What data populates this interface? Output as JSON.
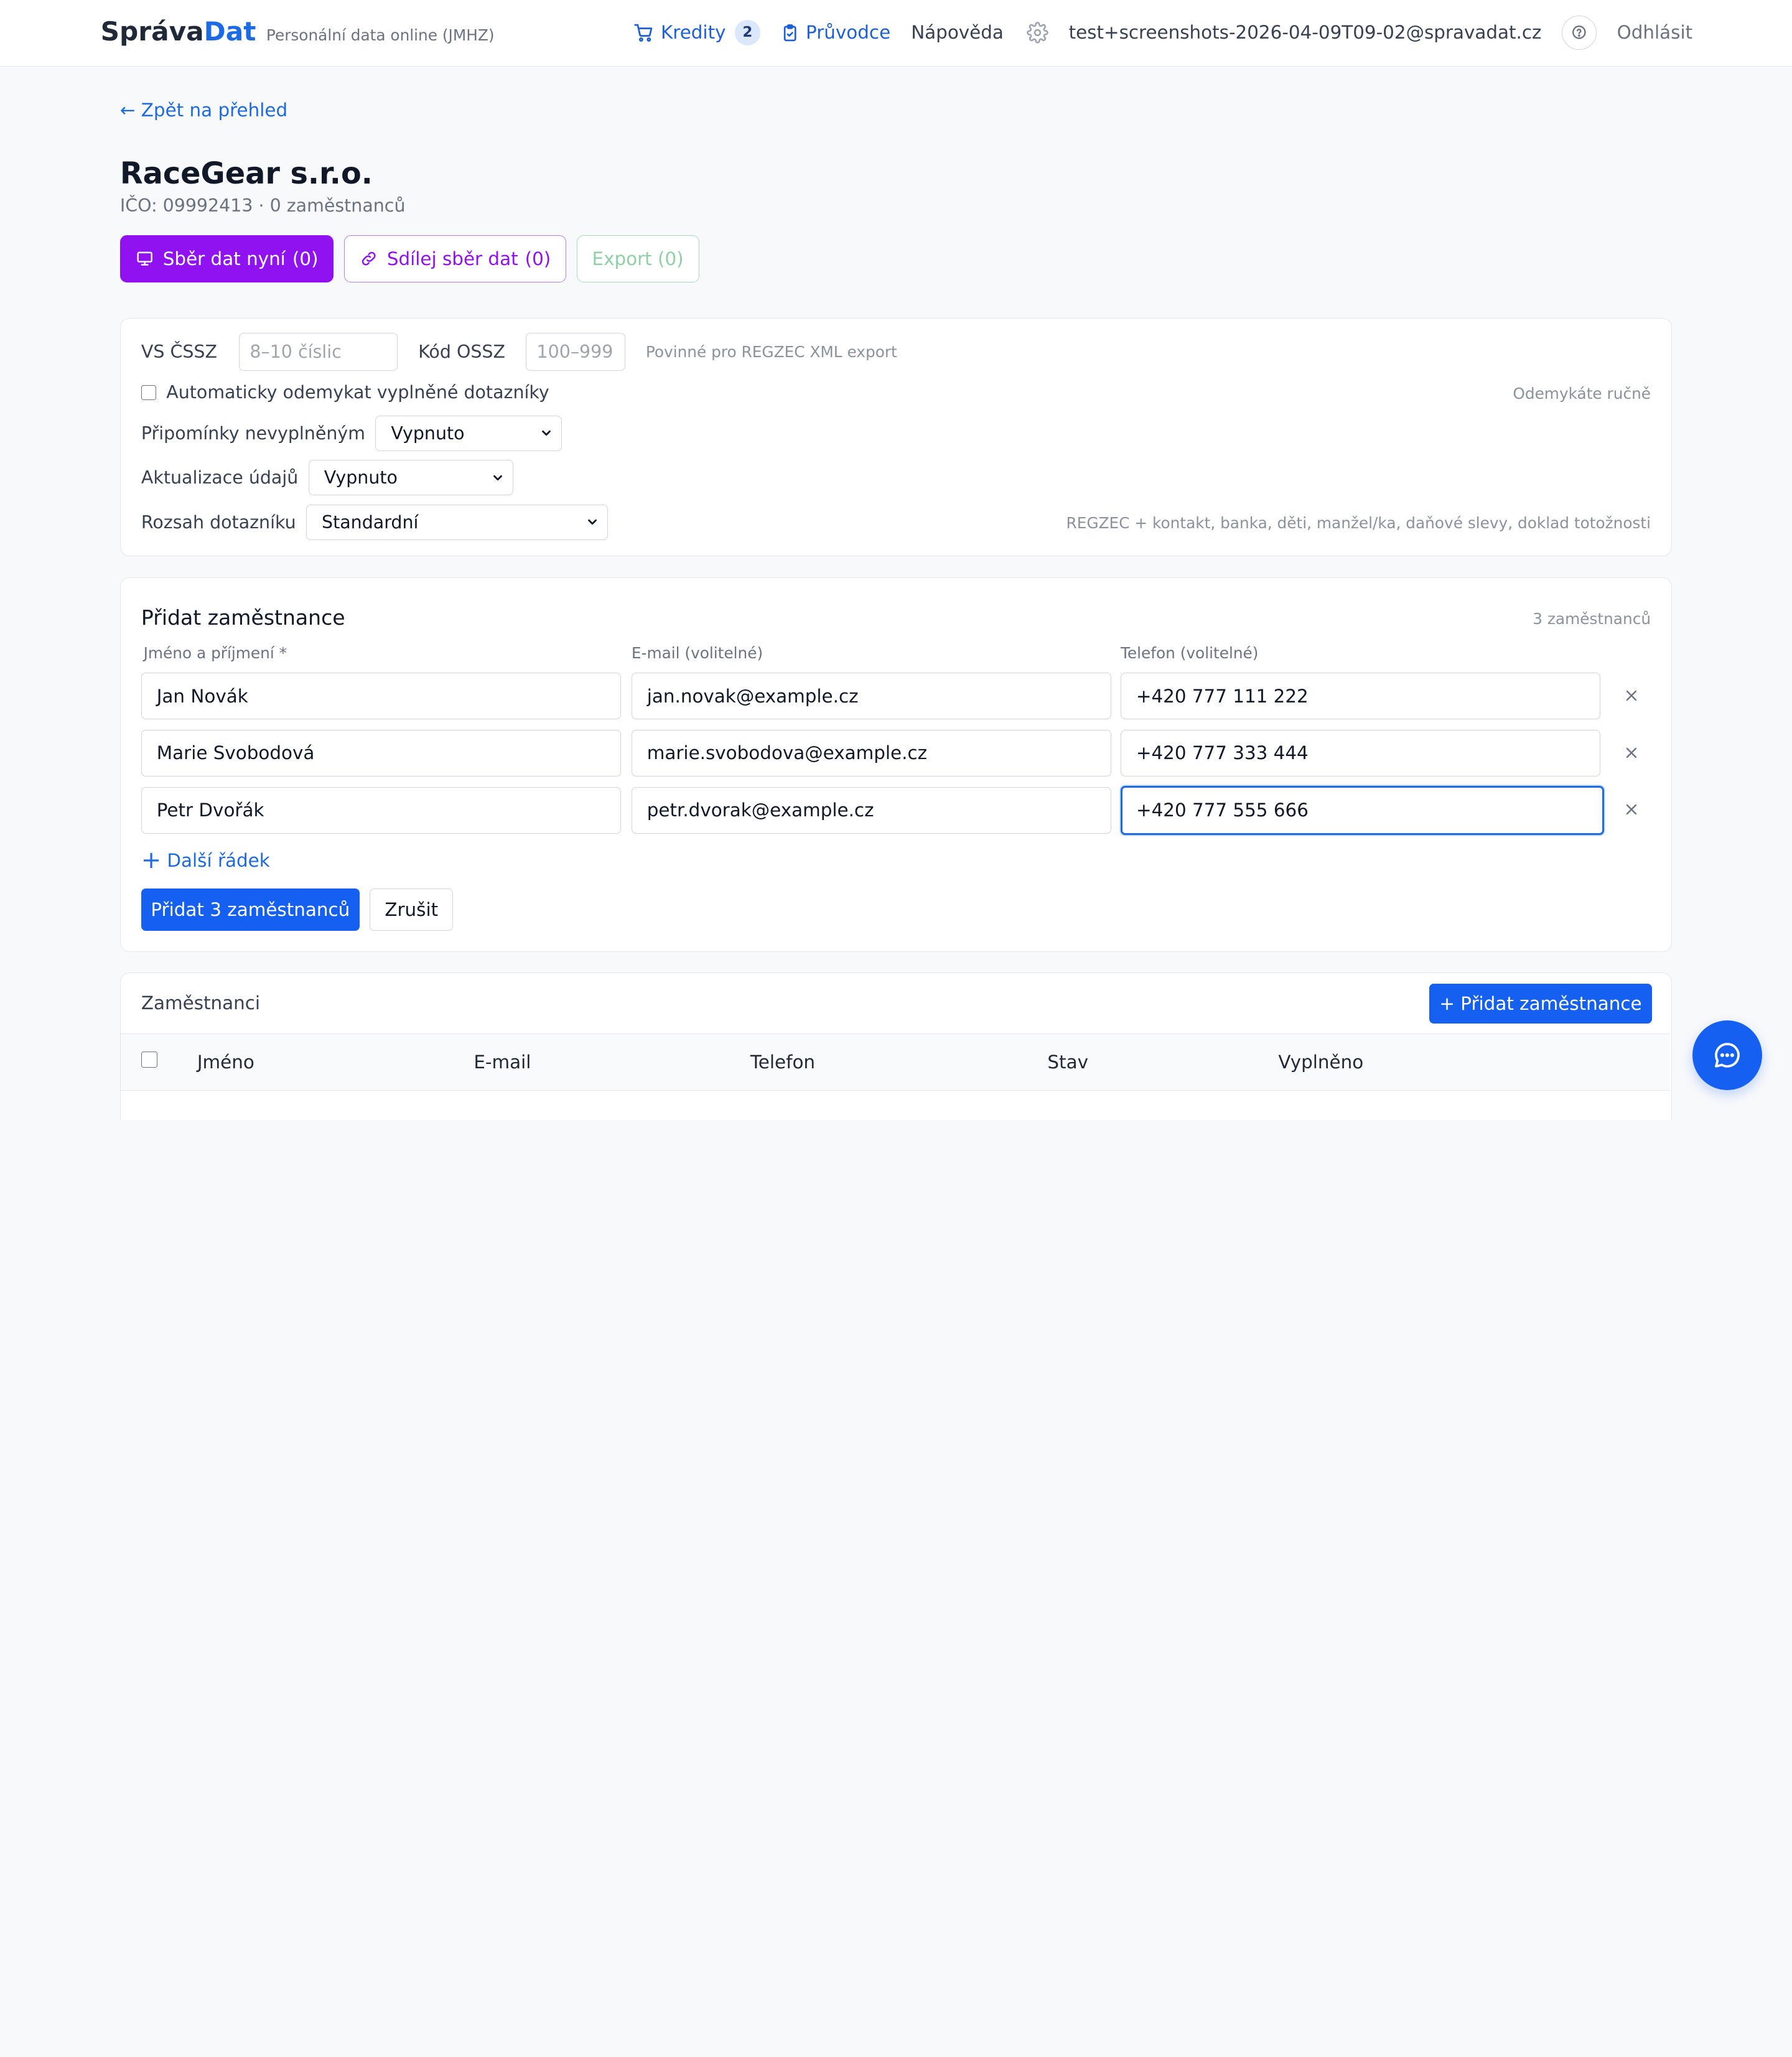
{
  "header": {
    "brand_part1": "Správa",
    "brand_part2": "Dat",
    "brand_subtitle": "Personální data online (JMHZ)",
    "nav": {
      "credits_label": "Kredity",
      "credits_count": "2",
      "guide_label": "Průvodce",
      "help_label": "Nápověda",
      "user_email": "test+screenshots-2026-04-09T09-02@spravadat.cz",
      "logout_label": "Odhlásit"
    }
  },
  "back_link": "← Zpět na přehled",
  "company": {
    "name": "RaceGear s.r.o.",
    "meta": "IČO: 09992413 · 0 zaměstnanců"
  },
  "actions": {
    "collect_now": "Sběr dat nyní",
    "collect_now_count": "(0)",
    "share_collect": "Sdílej sběr dat",
    "share_collect_count": "(0)",
    "export": "Export (0)"
  },
  "settings": {
    "vs_label": "VS ČSSZ",
    "vs_placeholder": "8–10 číslic",
    "ossz_label": "Kód OSSZ",
    "ossz_placeholder": "100–999",
    "ossz_hint": "Povinné pro REGZEC XML export",
    "auto_unlock_label": "Automaticky odemykat vyplněné dotazníky",
    "auto_unlock_hint": "Odemykáte ručně",
    "reminders_label": "Připomínky nevyplněným",
    "reminders_value": "Vypnuto",
    "updates_label": "Aktualizace údajů",
    "updates_value": "Vypnuto",
    "scope_label": "Rozsah dotazníku",
    "scope_value": "Standardní",
    "scope_hint": "REGZEC + kontakt, banka, děti, manžel/ka, daňové slevy, doklad totožnosti"
  },
  "add_employees": {
    "title": "Přidat zaměstnance",
    "count": "3 zaměstnanců",
    "col_name": "Jméno a příjmení *",
    "col_email": "E-mail (volitelné)",
    "col_phone": "Telefon (volitelné)",
    "rows": [
      {
        "name": "Jan Novák",
        "email": "jan.novak@example.cz",
        "phone": "+420 777 111 222"
      },
      {
        "name": "Marie Svobodová",
        "email": "marie.svobodova@example.cz",
        "phone": "+420 777 333 444"
      },
      {
        "name": "Petr Dvořák",
        "email": "petr.dvorak@example.cz",
        "phone": "+420 777 555 666"
      }
    ],
    "add_row": "Další řádek",
    "submit": "Přidat 3 zaměstnanců",
    "cancel": "Zrušit"
  },
  "employees": {
    "title": "Zaměstnanci",
    "add_button": "+ Přidat zaměstnance",
    "columns": [
      "Jméno",
      "E-mail",
      "Telefon",
      "Stav",
      "Vyplněno"
    ]
  },
  "colors": {
    "primary": "#1560f0",
    "purple": "#9012f0",
    "green_disabled": "#8fd0a5",
    "link": "#1d6ae5"
  }
}
